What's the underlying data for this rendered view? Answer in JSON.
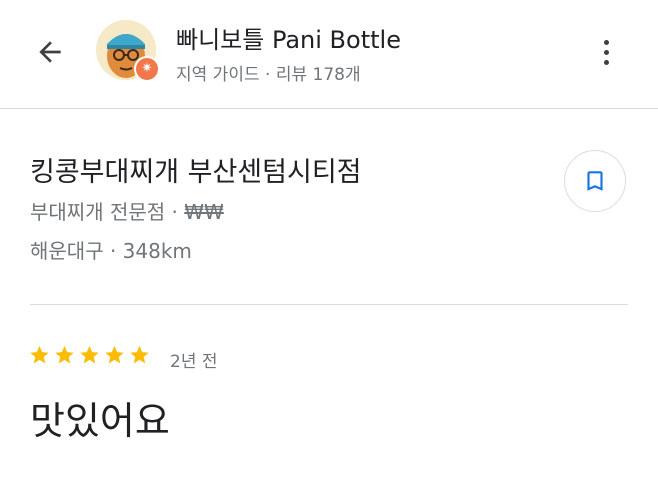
{
  "header": {
    "back_icon": "arrow-left-icon",
    "user_name": "빠니보틀 Pani Bottle",
    "user_meta": "지역 가이드 · 리뷰 178개",
    "badge_icon": "local-guide-star-icon",
    "badge_color": "#f2784b",
    "more_icon": "more-vertical-icon"
  },
  "place": {
    "name": "킹콩부대찌개 부산센텀시티점",
    "category": "부대찌개 전문점 · ",
    "price_level": "₩₩",
    "location": "해운대구 · 348km",
    "save_icon": "bookmark-icon",
    "accent_color": "#1a73e8"
  },
  "review": {
    "rating": 5,
    "max_rating": 5,
    "star_color": "#fbbc04",
    "date": "2년 전",
    "text": "맛있어요"
  }
}
